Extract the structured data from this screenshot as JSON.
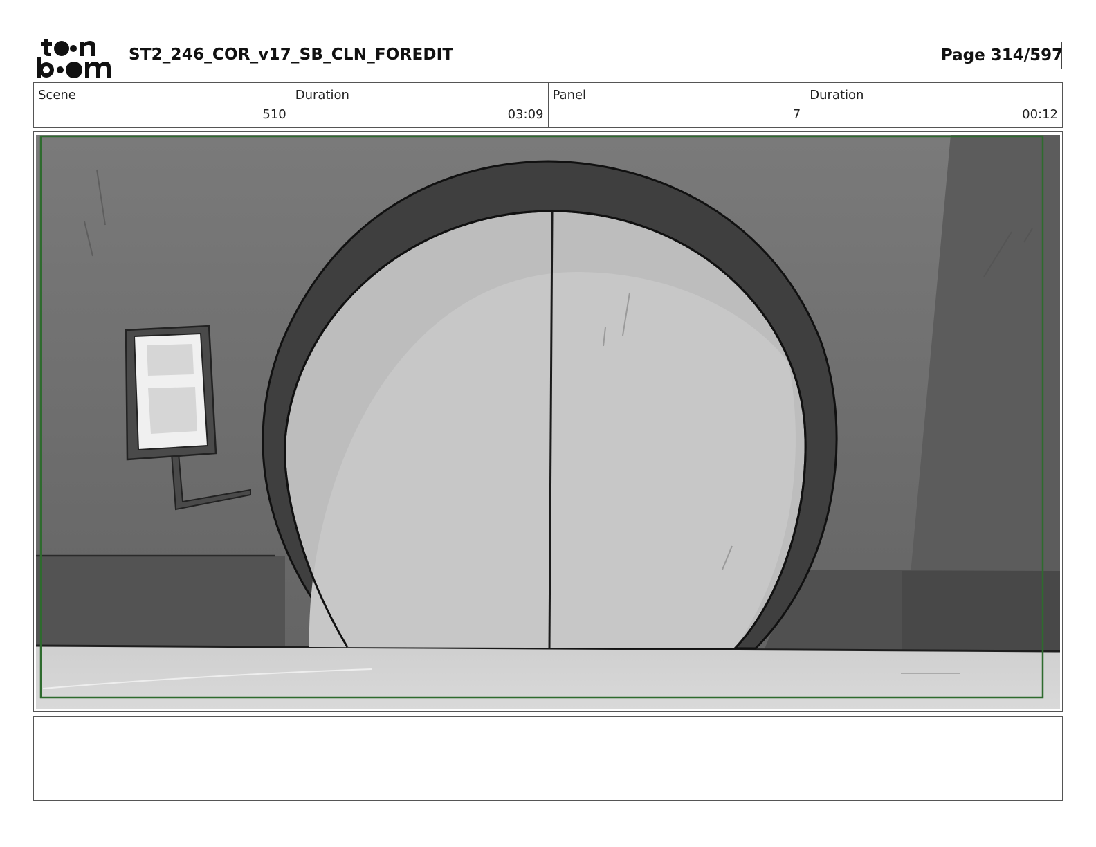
{
  "header": {
    "logo_text": "toon boom",
    "document_title": "ST2_246_COR_v17_SB_CLN_FOREDIT",
    "page_label": "Page 314/597"
  },
  "info": {
    "scene_label": "Scene",
    "scene_value": "510",
    "scene_duration_label": "Duration",
    "scene_duration_value": "03:09",
    "panel_label": "Panel",
    "panel_value": "7",
    "panel_duration_label": "Duration",
    "panel_duration_value": "00:12"
  },
  "panel": {
    "safe_frame_color": "#2e6b2e",
    "description_text": ""
  },
  "colors": {
    "wall": "#6f6f6f",
    "wall_dark": "#555555",
    "door_frame": "#404040",
    "door": "#c4c4c4",
    "floor": "#d0d0d0",
    "right_pillar": "#5e5e5e"
  }
}
